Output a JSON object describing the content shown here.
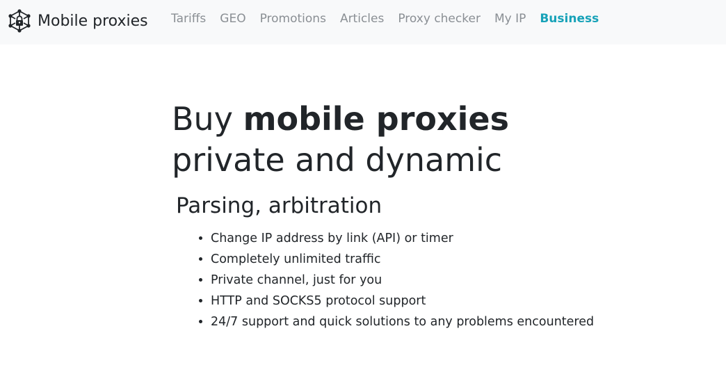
{
  "navbar": {
    "brand_icon": "network-lock-icon",
    "brand_label": "Mobile proxies",
    "links": [
      {
        "label": "Tariffs"
      },
      {
        "label": "GEO"
      },
      {
        "label": "Promotions"
      },
      {
        "label": "Articles"
      },
      {
        "label": "Proxy checker"
      },
      {
        "label": "My IP"
      },
      {
        "label": "Business",
        "active": true
      }
    ],
    "active_color": "#17a2b8"
  },
  "hero": {
    "title_part1": "Buy ",
    "title_bold": "mobile proxies",
    "title_line2": "private and dynamic",
    "subtitle": "Parsing, arbitration",
    "features": [
      "Change IP address by link (API) or timer",
      "Completely unlimited traffic",
      "Private channel, just for you",
      "HTTP and SOCKS5 protocol support",
      "24/7 support and quick solutions to any problems encountered"
    ]
  }
}
